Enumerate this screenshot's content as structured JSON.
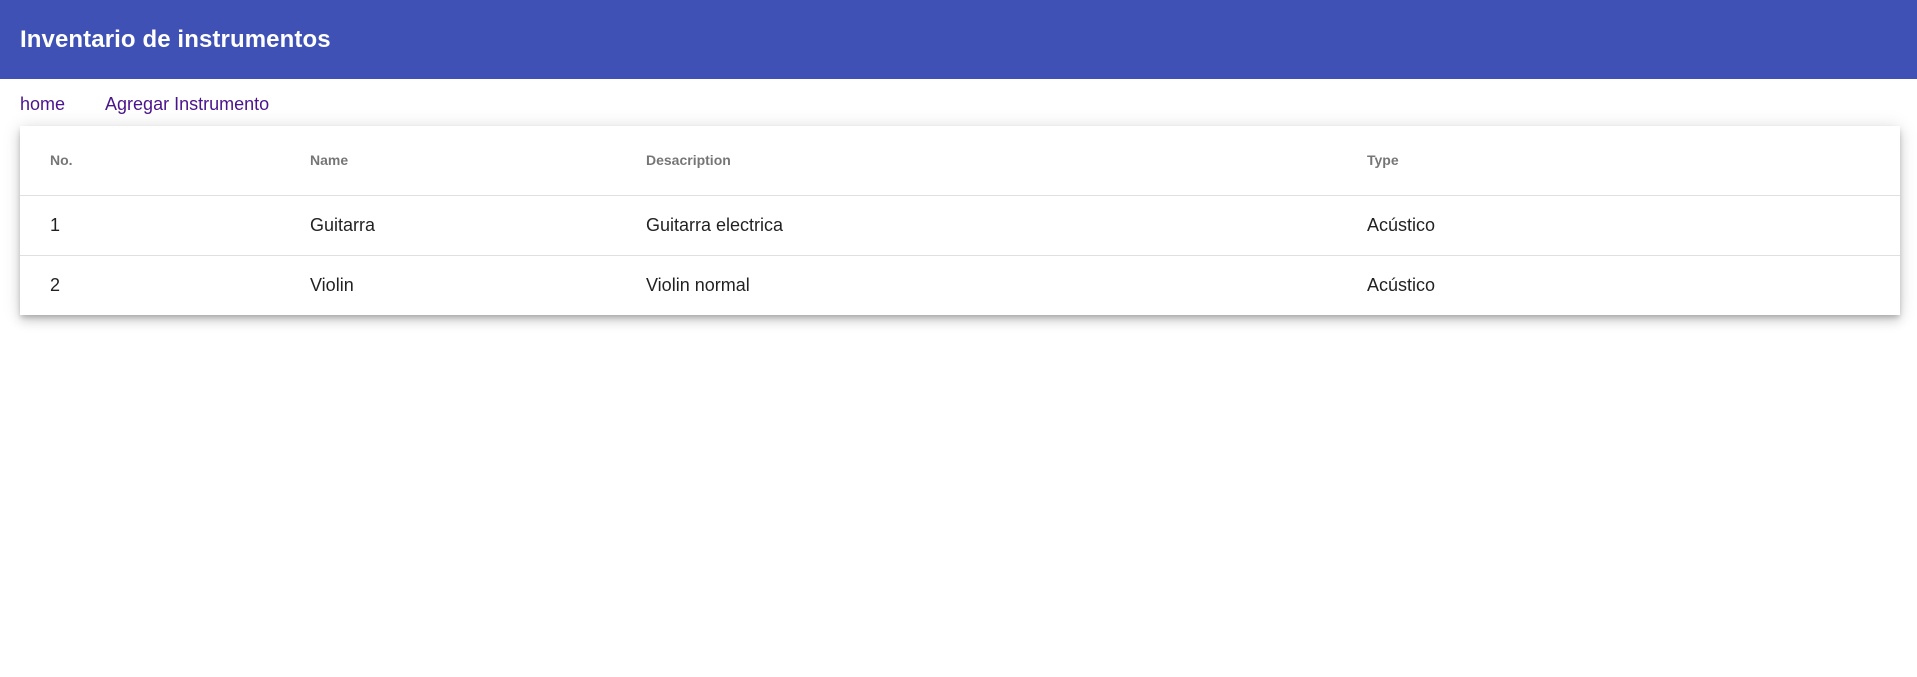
{
  "app_bar": {
    "title": "Inventario de instrumentos"
  },
  "nav": {
    "links": [
      {
        "label": "home"
      },
      {
        "label": "Agregar Instrumento"
      }
    ]
  },
  "table": {
    "headers": {
      "no": "No.",
      "name": "Name",
      "description": "Desacription",
      "type": "Type"
    },
    "rows": [
      {
        "no": "1",
        "name": "Guitarra",
        "description": "Guitarra electrica",
        "type": "Acústico"
      },
      {
        "no": "2",
        "name": "Violin",
        "description": "Violin normal",
        "type": "Acústico"
      }
    ]
  },
  "colors": {
    "primary": "#3f51b5",
    "link": "#4a148c"
  }
}
